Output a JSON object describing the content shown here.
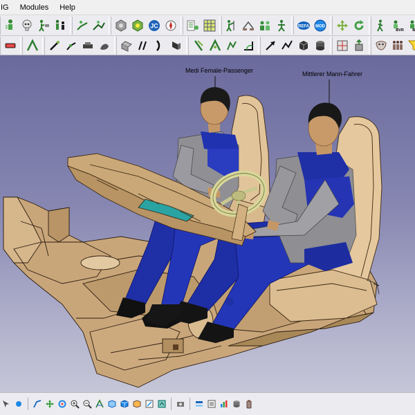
{
  "menu": {
    "items": [
      {
        "label": "IG"
      },
      {
        "label": "Modules"
      },
      {
        "label": "Help"
      }
    ]
  },
  "colors": {
    "viewport_top": "#6a6a9d",
    "viewport_bottom": "#c6c6d8",
    "shirt": "#1f2fa6",
    "skin": "#c89a6a",
    "seat": "#e2c49a",
    "dashboard": "#caa878",
    "toolbar_bg": "#ececf0"
  },
  "scene": {
    "labels": {
      "female": "Medi Female-Passenger",
      "male": "Mittlerer Mann-Fahrer"
    }
  },
  "toolbar1": {
    "icons": [
      "human-builder-icon",
      "skull-icon",
      "posture-icon",
      "family-icon",
      "seat-reference-icon",
      "manikin-vision-icon",
      "posture-edit-icon",
      "ergonomics-icon",
      "jc-icon",
      "compass-icon",
      "elbow-icon",
      "grid-calc-icon",
      "reach-envelope-icon",
      "scale-icon",
      "group-icon",
      "posture-analysis-icon",
      "refa-icon",
      "mdd-icon",
      "move-icon",
      "rotate-icon",
      "walk-icon",
      "bvr-icon",
      "bvr2-icon",
      "gesture-icon",
      "grasp-icon",
      "hand-icon",
      "hand2-icon",
      "hand3-icon"
    ]
  },
  "toolbar2": {
    "icons": [
      "red-tool-icon",
      "line-icon",
      "pencil-icon",
      "bend-icon",
      "constraint-icon",
      "shape-icon",
      "sweep-icon",
      "surface-icon",
      "curve-icon",
      "solid-icon",
      "bracket-icon",
      "line-green-icon",
      "sketch-icon",
      "angle-icon",
      "arrow-icon",
      "polyline-icon",
      "cube-icon",
      "tube-icon",
      "split-icon",
      "extrude-icon",
      "mask-icon",
      "people-icon",
      "filter-icon",
      "mannequin-icon"
    ]
  },
  "bottombar": {
    "icons": [
      "select-icon",
      "fly-icon",
      "fit-all-icon",
      "pan-icon",
      "rotate-view-icon",
      "zoom-in-icon",
      "zoom-out-icon",
      "normal-view-icon",
      "iso-view-icon",
      "cube-view-icon",
      "shading-icon",
      "hide-show-icon",
      "swap-icon",
      "camera-icon",
      "measure-icon",
      "properties-icon",
      "bar-chart-icon",
      "database-icon",
      "battery-icon"
    ]
  }
}
